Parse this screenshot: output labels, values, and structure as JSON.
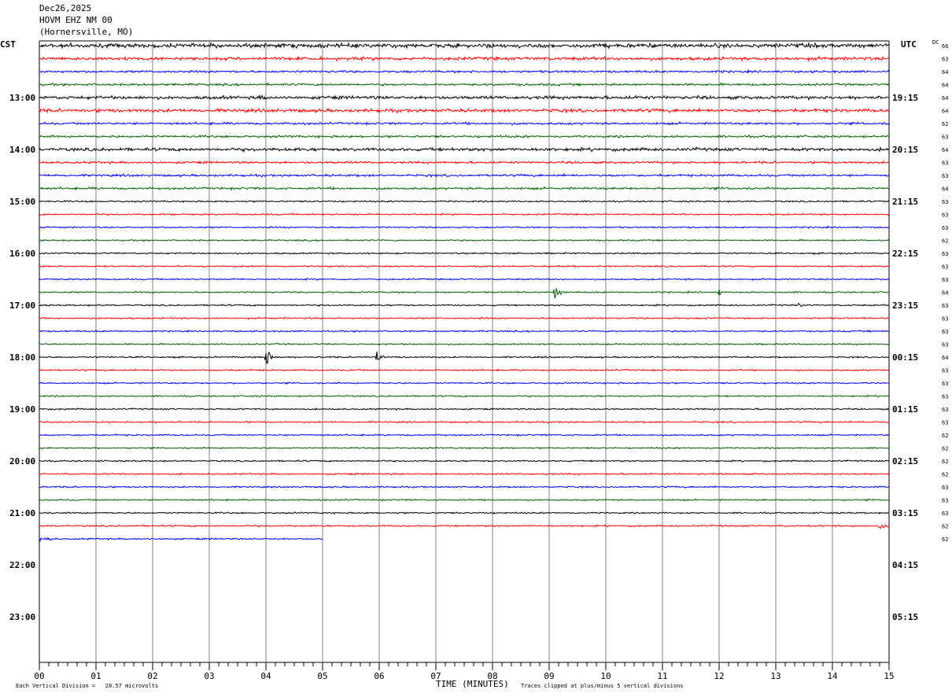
{
  "header": {
    "date": "Dec26,2025",
    "station": "HOVM EHZ NM 00",
    "location": "(Hornersville, MO)"
  },
  "left_timezone": "CST",
  "right_timezone": "UTC",
  "dc_label": "DC",
  "footer": {
    "scale_note": "Each Vertical Division =   28.57 microvolts",
    "xaxis_title": "TIME (MINUTES)",
    "clip_note": "Traces clipped at plus/minus 5 vertical divisions"
  },
  "colors": {
    "cycle": [
      "#000000",
      "#ff0000",
      "#0000ff",
      "#006400"
    ],
    "grid": "#808080"
  },
  "chart_data": {
    "type": "line",
    "title": "HOVM EHZ NM 00",
    "xlabel": "TIME (MINUTES)",
    "x_ticks": [
      "00",
      "01",
      "02",
      "03",
      "04",
      "05",
      "06",
      "07",
      "08",
      "09",
      "10",
      "11",
      "12",
      "13",
      "14",
      "15"
    ],
    "xlim": [
      0,
      15
    ],
    "trace_minutes": 15,
    "left_hour_labels": [
      "13:00",
      "14:00",
      "15:00",
      "16:00",
      "17:00",
      "18:00",
      "19:00",
      "20:00",
      "21:00",
      "22:00",
      "23:00"
    ],
    "right_hour_labels": [
      "19:15",
      "20:15",
      "21:15",
      "22:15",
      "23:15",
      "00:15",
      "01:15",
      "02:15",
      "03:15",
      "04:15",
      "05:15"
    ],
    "dc_offsets": [
      66,
      63,
      64,
      64,
      64,
      64,
      62,
      63,
      64,
      63,
      63,
      64,
      63,
      63,
      63,
      62,
      63,
      63,
      63,
      64,
      63,
      63,
      63,
      63,
      64,
      63,
      63,
      63,
      63,
      63,
      62,
      62,
      62,
      62,
      63,
      63,
      63,
      62,
      62
    ],
    "last_trace_end_minute": 5,
    "events": [
      {
        "trace": 4,
        "minute": 3.9,
        "amp": 4
      },
      {
        "trace": 13,
        "minute": 2.3,
        "amp": 3
      },
      {
        "trace": 19,
        "minute": 9.1,
        "amp": 9
      },
      {
        "trace": 19,
        "minute": 12.0,
        "amp": 4
      },
      {
        "trace": 20,
        "minute": 13.4,
        "amp": 3
      },
      {
        "trace": 24,
        "minute": 4.0,
        "amp": 12
      },
      {
        "trace": 24,
        "minute": 5.95,
        "amp": 8
      },
      {
        "trace": 37,
        "minute": 14.8,
        "amp": 7
      }
    ]
  }
}
